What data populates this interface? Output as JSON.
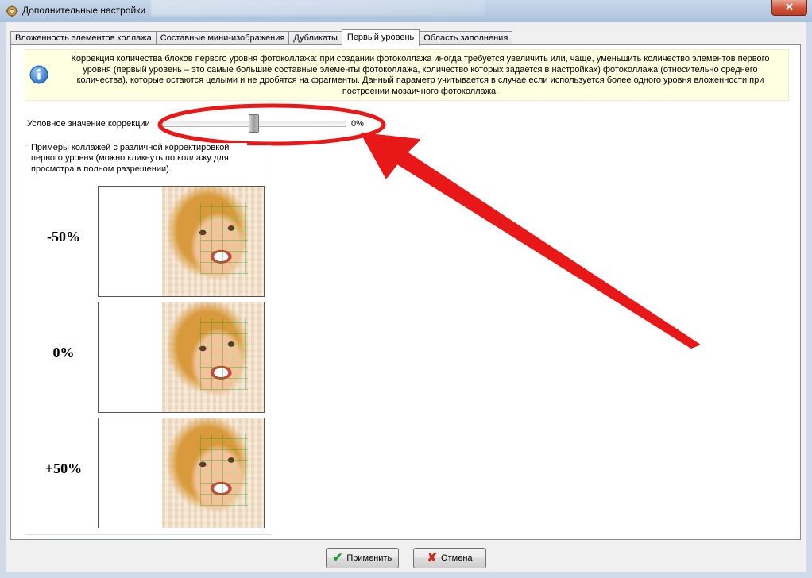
{
  "window": {
    "title": "Дополнительные настройки",
    "close_label": "✕"
  },
  "tabs": [
    {
      "label": "Вложенность элементов коллажа",
      "active": false
    },
    {
      "label": "Составные мини-изображения",
      "active": false
    },
    {
      "label": "Дубликаты",
      "active": false
    },
    {
      "label": "Первый уровень",
      "active": true
    },
    {
      "label": "Область заполнения",
      "active": false
    }
  ],
  "info": {
    "icon": "info-icon",
    "lines": [
      "Коррекция количества блоков первого уровня фотоколлажа: при создании фотоколлажа иногда требуется увеличить или, чаще, уменьшить количество элементов первого",
      "уровня (первый уровень – это самые большие составные элементы фотоколлажа, количество которых задается в настройках) фотоколлажа (относительно среднего",
      "количества), которые остаются целыми и не дробятся на фрагменты. Данный параметр учитывается в случае если используется более одного уровня вложенности при",
      "построении мозаичного фотоколлажа."
    ]
  },
  "correction": {
    "label": "Условное значение коррекции",
    "value_text": "0%",
    "value": 0
  },
  "examples": {
    "caption": "Примеры коллажей с различной корректировкой первого уровня (можно кликнуть по коллажу для просмотра в полном разрешении).",
    "items": [
      {
        "label": "-50%"
      },
      {
        "label": "0%"
      },
      {
        "label": "+50%"
      }
    ]
  },
  "buttons": {
    "ok_label": "Применить",
    "cancel_label": "Отмена"
  },
  "colors": {
    "annotation": "#e81818",
    "info_bg": "#ffffe1",
    "tab_border": "#898c95"
  }
}
